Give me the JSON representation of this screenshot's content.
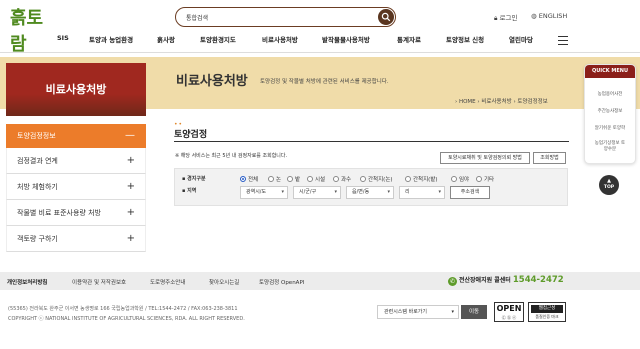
{
  "header": {
    "logo_text": "흙토람",
    "search_placeholder": "통합검색",
    "login_label": "로그인",
    "english_label": "ENGLISH"
  },
  "gnb": {
    "items": [
      "SIS",
      "토양과 농업환경",
      "흙사랑",
      "토양환경지도",
      "비료사용처방",
      "밭작물물사용처방",
      "통계자료",
      "토양정보 신청",
      "열린마당"
    ]
  },
  "banner": {
    "lnb_title": "비료사용처방",
    "page_title": "비료사용처방",
    "page_desc": "토양검정 및 작물별 처방에 관련된 서비스를 제공합니다.",
    "breadcrumb": [
      "HOME",
      "비료사용처방",
      "토양검정정보"
    ]
  },
  "lnb": {
    "items": [
      {
        "label": "토양검정정보",
        "sign": "—"
      },
      {
        "label": "검정결과 연계",
        "sign": "+"
      },
      {
        "label": "처방 체험하기",
        "sign": "+"
      },
      {
        "label": "작물별 비료 표준사용량 처방",
        "sign": "+"
      },
      {
        "label": "객토량 구하기",
        "sign": "+"
      }
    ]
  },
  "content": {
    "title": "토양검정",
    "notice": "※ 해당 서비스는 최근 5년 내 검정자료를 조회합니다.",
    "btn_guide": "토양시료채취 및 토양검정의뢰 방법",
    "btn_view": "조회방법",
    "form": {
      "label_kind": "경지구분",
      "label_region": "지역",
      "radios": [
        "전체",
        "논",
        "밭",
        "시설",
        "과수",
        "간척지(논)",
        "간척지(밭)",
        "임야",
        "기타"
      ],
      "selected_radio": "전체",
      "sido": "광역시/도",
      "sigungu": "시/군/구",
      "eupmyeon": "읍/면/동",
      "ri": "리",
      "btn_address": "주소검색"
    }
  },
  "quick": {
    "title": "QUICK MENU",
    "items": [
      "농업용어사전",
      "주간농사정보",
      "알기쉬운 토양학",
      "농업기상정보 토양수분"
    ],
    "top_label": "TOP"
  },
  "footer": {
    "links": [
      "개인정보처리방침",
      "저작권정책",
      "이용약관 및 저작권보호",
      "도로명주소안내",
      "찾아오시는길",
      "토양검정 OpenAPI"
    ],
    "hotline_label": "전산장애지원 콜센터",
    "hotline_number": "1544-2472",
    "address": "(55365) 전라북도 완주군 이서면 농생명로 166 국립농업과학원 / TEL:1544-2472 / FAX:063-238-3811",
    "copyright": "COPYRIGHT ⓒ NATIONAL INSTITUTE OF AGRICULTURAL SCIENCES, RDA. ALL RIGHT RESERVED.",
    "related_site": "관련시스템 바로가기",
    "go_button": "이동",
    "badge_open": "OPEN",
    "badge_web": "웹접근성",
    "badge_web_sub": "품질인증 마크"
  }
}
